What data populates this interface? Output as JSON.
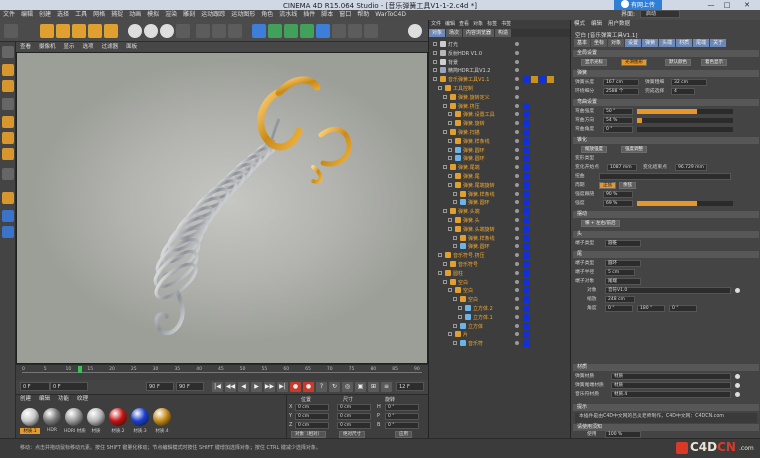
{
  "window": {
    "title": "CINEMA 4D R15.064 Studio - [音乐弹簧工具V1-1-2.c4d *]",
    "cloud_button": "有网上传",
    "controls": [
      "—",
      "□",
      "✕"
    ]
  },
  "menubar": {
    "items": [
      "文件",
      "编辑",
      "创建",
      "选择",
      "工具",
      "网格",
      "捕捉",
      "动画",
      "模拟",
      "渲染",
      "雕刻",
      "运动跟踪",
      "运动图形",
      "角色",
      "流水线",
      "插件",
      "脚本",
      "窗口",
      "帮助",
      "WarToC4D"
    ],
    "layout_label": "界面:",
    "layout_value": "启动"
  },
  "viewport_menu": [
    "查看",
    "摄像机",
    "显示",
    "选项",
    "过滤器",
    "面板"
  ],
  "timeline": {
    "ticks": [
      "0",
      "5",
      "10",
      "15",
      "20",
      "25",
      "30",
      "35",
      "40",
      "45",
      "50",
      "55",
      "60",
      "65",
      "70",
      "75",
      "80",
      "85",
      "90"
    ],
    "current_frame": "0 F",
    "start_frame": "0 F",
    "end_frame": "90 F",
    "end_frame_2": "90 F",
    "frame_counter": "12 F",
    "playhead_fraction": 0.14,
    "buttons": [
      "|◀",
      "◀◀",
      "◀",
      "▶",
      "▶▶",
      "▶|",
      "●",
      "●",
      "?",
      "↻",
      "◎",
      "▣",
      "⊞",
      "≡"
    ]
  },
  "material_manager": {
    "menu": [
      "创建",
      "编辑",
      "功能",
      "纹理"
    ],
    "materials": [
      {
        "label": "材质.1",
        "color": "#c8c8c8",
        "selected": true
      },
      {
        "label": "HDR",
        "color": "#7b7b7b",
        "selected": false
      },
      {
        "label": "HDRI 材质",
        "color": "#9a9a9a",
        "selected": false
      },
      {
        "label": "材质",
        "color": "#b5b5b5",
        "selected": false
      },
      {
        "label": "材质.2",
        "color": "#c51313",
        "selected": false
      },
      {
        "label": "材质.3",
        "color": "#1c3fd0",
        "selected": false
      },
      {
        "label": "材质.4",
        "color": "#c48a19",
        "selected": false
      }
    ]
  },
  "coordinates": {
    "headers": [
      "位置",
      "尺寸",
      "旋转"
    ],
    "rows": [
      {
        "axis": "X",
        "pos": "0 cm",
        "size": "0 cm",
        "rot_label": "H",
        "rot": "0 °"
      },
      {
        "axis": "Y",
        "pos": "0 cm",
        "size": "0 cm",
        "rot_label": "P",
        "rot": "0 °"
      },
      {
        "axis": "Z",
        "pos": "0 cm",
        "size": "0 cm",
        "rot_label": "B",
        "rot": "0 °"
      }
    ],
    "mode_1": "对象（相对）",
    "mode_2": "绝对尺寸",
    "apply": "应用"
  },
  "status_text": "移动：点击并拖动鼠标移动元素。按住 SHIFT 键量化移动；节点编辑模式时按住 SHIFT 键增加选择对象；按住 CTRL 键减少选择对象。",
  "watermark": {
    "part1": "C4D",
    "part2": "CN",
    "com": ".com"
  },
  "object_manager": {
    "menu": [
      "文件",
      "编辑",
      "查看",
      "对象",
      "标签",
      "书签"
    ],
    "tabs": [
      "对象",
      "场次",
      "内容浏览器",
      "构造"
    ],
    "rows": [
      {
        "name": "灯光",
        "depth": 0,
        "active": false,
        "icon": "#cccccc",
        "tag": "none"
      },
      {
        "name": "反射HDR V1.0",
        "depth": 0,
        "active": false,
        "icon": "#b8b8b8",
        "tag": "none"
      },
      {
        "name": "背景",
        "depth": 0,
        "active": false,
        "icon": "#d0d0d0",
        "tag": "none"
      },
      {
        "name": "精简HDR工具V1.2",
        "depth": 0,
        "active": false,
        "icon": "#9aa5c0",
        "tag": "none"
      },
      {
        "name": "音乐弹簧工具V1.1",
        "depth": 0,
        "active": true,
        "icon": "#e0a030",
        "tag": "mat"
      },
      {
        "name": "工具控制",
        "depth": 1,
        "active": true,
        "icon": "#e0a030",
        "tag": "none"
      },
      {
        "name": "弹簧.旋转定义",
        "depth": 2,
        "active": true,
        "icon": "#e0a030",
        "tag": "none"
      },
      {
        "name": "弹簧.挤压",
        "depth": 2,
        "active": true,
        "icon": "#e0a030",
        "tag": "blue"
      },
      {
        "name": "弹簧.设置工具",
        "depth": 3,
        "active": true,
        "icon": "#e0a030",
        "tag": "blue"
      },
      {
        "name": "弹簧.旋转",
        "depth": 3,
        "active": true,
        "icon": "#e0a030",
        "tag": "blue"
      },
      {
        "name": "弹簧.扫描",
        "depth": 2,
        "active": true,
        "icon": "#e0a030",
        "tag": "blue"
      },
      {
        "name": "弹簧.样条线",
        "depth": 3,
        "active": true,
        "icon": "#e0a030",
        "tag": "blue"
      },
      {
        "name": "弹簧.圆环",
        "depth": 3,
        "active": true,
        "icon": "#6bb4e8",
        "tag": "blue"
      },
      {
        "name": "弹簧.圆环",
        "depth": 3,
        "active": true,
        "icon": "#6bb4e8",
        "tag": "blue"
      },
      {
        "name": "弹簧.尾端",
        "depth": 2,
        "active": true,
        "icon": "#e0a030",
        "tag": "blue"
      },
      {
        "name": "弹簧.尾",
        "depth": 3,
        "active": true,
        "icon": "#e0a030",
        "tag": "blue"
      },
      {
        "name": "弹簧.尾端旋转",
        "depth": 3,
        "active": true,
        "icon": "#e0a030",
        "tag": "blue"
      },
      {
        "name": "弹簧.样条线",
        "depth": 4,
        "active": true,
        "icon": "#e0a030",
        "tag": "blue"
      },
      {
        "name": "弹簧.圆环",
        "depth": 4,
        "active": true,
        "icon": "#6bb4e8",
        "tag": "blue"
      },
      {
        "name": "弹簧.头端",
        "depth": 2,
        "active": true,
        "icon": "#e0a030",
        "tag": "blue"
      },
      {
        "name": "弹簧.头",
        "depth": 3,
        "active": true,
        "icon": "#e0a030",
        "tag": "blue"
      },
      {
        "name": "弹簧.头端旋转",
        "depth": 3,
        "active": true,
        "icon": "#e0a030",
        "tag": "blue"
      },
      {
        "name": "弹簧.样条线",
        "depth": 4,
        "active": true,
        "icon": "#e0a030",
        "tag": "blue"
      },
      {
        "name": "弹簧.圆环",
        "depth": 4,
        "active": true,
        "icon": "#6bb4e8",
        "tag": "blue"
      },
      {
        "name": "音乐符号.挤压",
        "depth": 1,
        "active": true,
        "icon": "#e0a030",
        "tag": "blue"
      },
      {
        "name": "音乐符号",
        "depth": 2,
        "active": true,
        "icon": "#e0a030",
        "tag": "blue"
      },
      {
        "name": "圆柱",
        "depth": 1,
        "active": true,
        "icon": "#e0a030",
        "tag": "blue"
      },
      {
        "name": "空白",
        "depth": 2,
        "active": true,
        "icon": "#e0a030",
        "tag": "blue"
      },
      {
        "name": "空白",
        "depth": 3,
        "active": true,
        "icon": "#e0a030",
        "tag": "blue"
      },
      {
        "name": "空白",
        "depth": 4,
        "active": true,
        "icon": "#e0a030",
        "tag": "blue"
      },
      {
        "name": "立方体.2",
        "depth": 5,
        "active": true,
        "icon": "#6bb4e8",
        "tag": "blue"
      },
      {
        "name": "立方体.1",
        "depth": 5,
        "active": true,
        "icon": "#6bb4e8",
        "tag": "blue"
      },
      {
        "name": "立方体",
        "depth": 4,
        "active": true,
        "icon": "#6bb4e8",
        "tag": "blue"
      },
      {
        "name": "片",
        "depth": 3,
        "active": true,
        "icon": "#e0a030",
        "tag": "blue"
      },
      {
        "name": "音乐符",
        "depth": 4,
        "active": true,
        "icon": "#6bb4e8",
        "tag": "blue"
      }
    ]
  },
  "attributes": {
    "menu": [
      "模式",
      "编辑",
      "用户数据"
    ],
    "object_name": "空白 [音乐弹簧工具V1.1]",
    "tabs": [
      "基本",
      "坐标",
      "对象",
      "设置",
      "弹簧",
      "头端",
      "材质",
      "尾端",
      "关于"
    ],
    "active_tabs": [
      "设置",
      "弹簧",
      "头端",
      "材质",
      "尾端",
      "关于"
    ],
    "s_general": "全局设置",
    "mode_buttons": [
      "显示光标",
      "光滑图形",
      "默认颜色",
      "着色显示"
    ],
    "s_main": "弹簧",
    "length_label": "弹簧长度",
    "length_value": "167 cm",
    "radius_label": "弹簧粗细",
    "radius_value": "32 cm",
    "seg_label": "环绕细分",
    "seg_value": "2588 个",
    "step_label": "完成选择",
    "step_value": "4",
    "s_bend": "弯曲设置",
    "bend_1_label": "弯曲强度",
    "bend_1_value": "50 °",
    "bend_1_fraction": 0.63,
    "bend_2_label": "弯曲方向",
    "bend_2_value": "54 %",
    "bend_2_fraction": 0.05,
    "bend_3_label": "弯曲角度",
    "bend_3_value": "0 °",
    "bend_3_fraction": 0.0,
    "s_taper": "锥化",
    "taper_buttons": [
      "缩放强度",
      "强度调整"
    ],
    "taper_label": "变形类型",
    "taper_from_label": "变化开始点",
    "taper_from_value": "1087 mm",
    "taper_to_label": "变化结束点",
    "taper_to_value": "96.729 mm",
    "twist_label": "扭曲",
    "cycle_label": "周期",
    "cycle_buttons": [
      "正弦",
      "余弦"
    ],
    "strength_label": "强度跟随",
    "strength_value": "90 %",
    "blend_label": "强度",
    "blend_value": "69 %",
    "blend_fraction": 0.62,
    "s_wobble": "摆动",
    "wobble_button": "横 + 左右/前后",
    "s_head": "头",
    "head_label": "端子类型",
    "head_value": "圆锥",
    "s_tail": "尾",
    "tail_type_label": "端子类型",
    "tail_type_value": "圆环",
    "tail_radius_label": "端子半径",
    "tail_radius_value": "5 cm",
    "tail_object_label": "端子对象",
    "tail_object_value": "尾端",
    "link_label": "对象",
    "link_value": "音符V1.0",
    "scale_label": "缩放",
    "scale_value": "248 cm",
    "angle_label": "角度",
    "angle_values": [
      "0 °",
      "180 °",
      "0 °"
    ],
    "s_mat": "材质",
    "mat_rows": [
      {
        "label": "弹簧材质",
        "value": "材质"
      },
      {
        "label": "弹簧尾端材质",
        "value": "材质"
      },
      {
        "label": "音乐符材质",
        "value": "材质.4"
      }
    ],
    "s_about": "提示",
    "about_text": "本插件是由C4D中文网的吕炎老师制作，C4D中文网：C4DCN.com",
    "s_link": "请使用须知",
    "link_row_label": "使用",
    "link_row_value": "100 %"
  }
}
